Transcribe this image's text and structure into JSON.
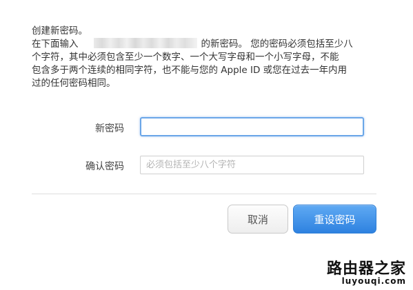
{
  "instructions": {
    "heading": "创建新密码。",
    "line2_prefix": "在下面输入",
    "line2_suffix": "的新密码。 您的密码必须包括至少八",
    "line3": "个字符，其中必须包含至少一个数字、一个大写字母和一个小写字母，不能",
    "line4": "包含多于两个连续的相同字符，也不能与您的 Apple ID 或您在过去一年内用",
    "line5": "过的任何密码相同。"
  },
  "form": {
    "new_password_label": "新密码",
    "new_password_value": "",
    "confirm_password_label": "确认密码",
    "confirm_password_placeholder": "必须包括至少八个字符",
    "confirm_password_value": ""
  },
  "buttons": {
    "cancel_label": "取消",
    "reset_label": "重设密码"
  },
  "watermark": {
    "main": "路由器之家",
    "sub": "luyouqi.com"
  },
  "colors": {
    "accent": "#2e82e0",
    "focus_border": "#6aa6e8"
  }
}
